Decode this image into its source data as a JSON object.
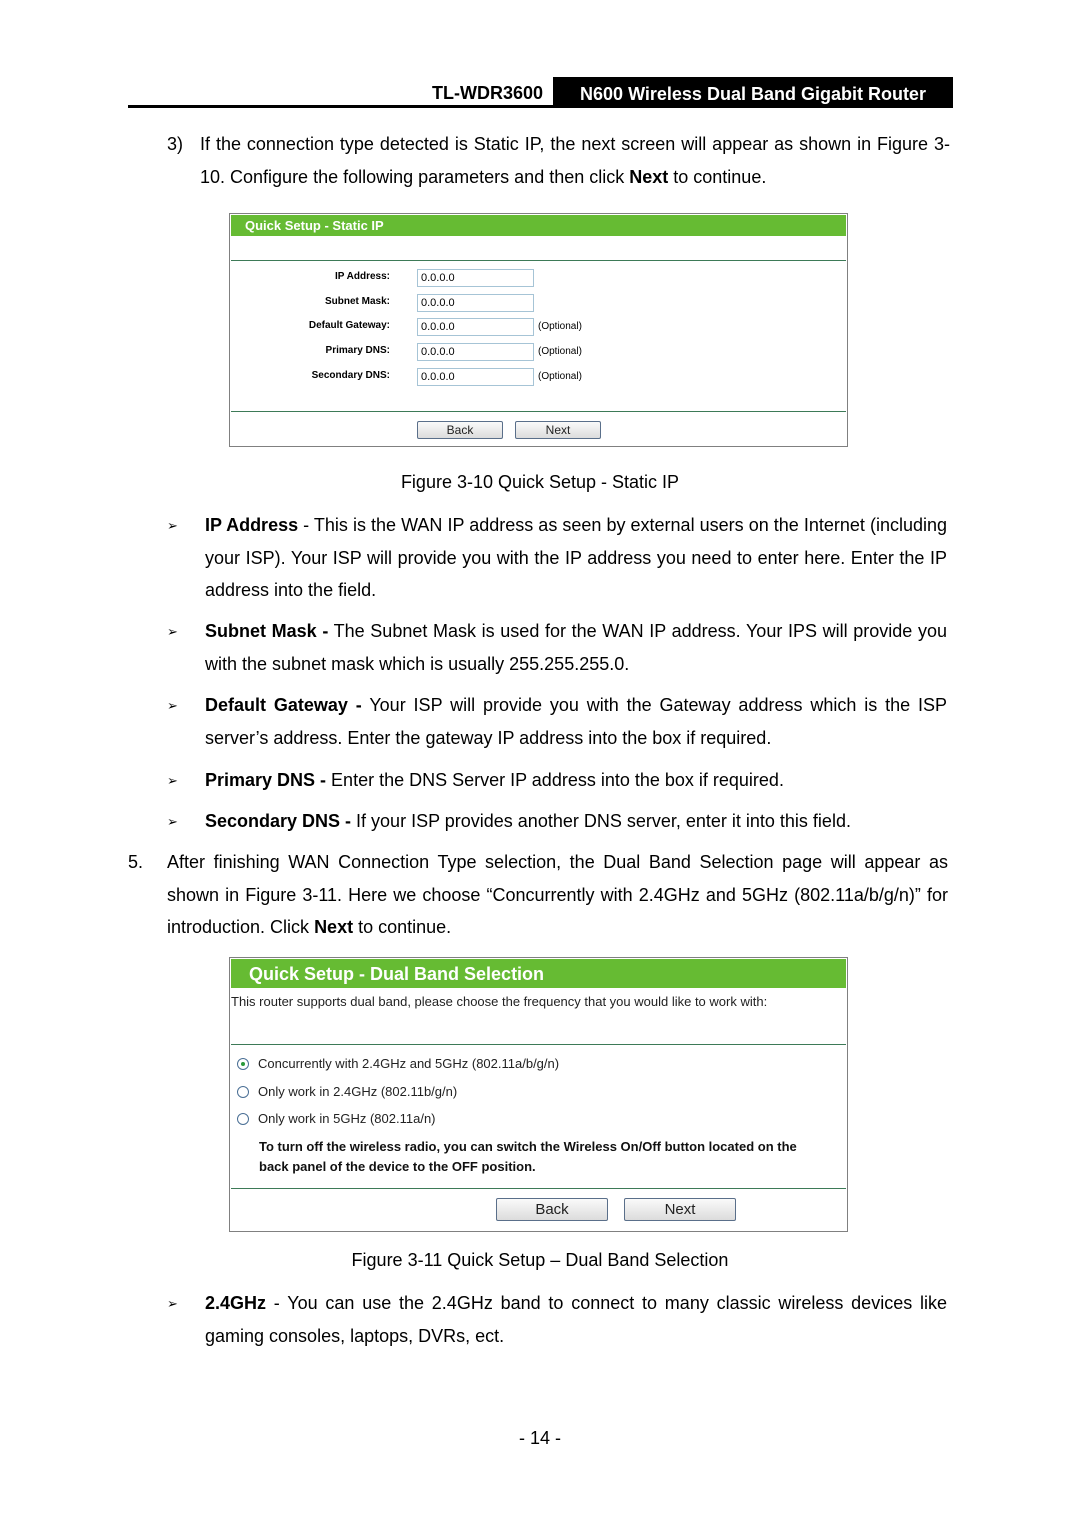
{
  "header": {
    "model": "TL-WDR3600",
    "product": "N600 Wireless Dual Band Gigabit Router"
  },
  "step3": {
    "num": "3)",
    "text_a": "If the connection type detected is Static IP, the next screen will appear as shown in Figure 3-10. Configure the following parameters and then click ",
    "bold": "Next",
    "text_b": " to continue."
  },
  "fig1": {
    "title": "Quick Setup - Static IP",
    "fields": [
      {
        "label": "IP Address:",
        "value": "0.0.0.0",
        "note": ""
      },
      {
        "label": "Subnet Mask:",
        "value": "0.0.0.0",
        "note": ""
      },
      {
        "label": "Default Gateway:",
        "value": "0.0.0.0",
        "note": "(Optional)"
      },
      {
        "label": "Primary DNS:",
        "value": "0.0.0.0",
        "note": "(Optional)"
      },
      {
        "label": "Secondary DNS:",
        "value": "0.0.0.0",
        "note": "(Optional)"
      }
    ],
    "back": "Back",
    "next": "Next",
    "caption": "Figure 3-10 Quick Setup - Static IP"
  },
  "bullets1": [
    {
      "bold": "IP Address",
      "text": " - This is the WAN IP address as seen by external users on the Internet (including your ISP). Your ISP will provide you with the IP address you need to enter here. Enter the IP address into the field."
    },
    {
      "bold": "Subnet Mask -",
      "text": " The Subnet Mask is used for the WAN IP address. Your IPS will provide you with the subnet mask which is usually 255.255.255.0."
    },
    {
      "bold": "Default Gateway -",
      "text": " Your ISP will provide you with the Gateway address which is the ISP server’s address. Enter the gateway IP address into the box if required."
    },
    {
      "bold": "Primary DNS -",
      "text": " Enter the DNS Server IP address into the box if required."
    },
    {
      "bold": "Secondary DNS -",
      "text": " If your ISP provides another DNS server, enter it into this field."
    }
  ],
  "step5": {
    "num": "5.",
    "text_a": "After finishing WAN Connection Type selection, the Dual Band Selection page will appear as shown in Figure 3-11. Here we choose “Concurrently with 2.4GHz and 5GHz (802.11a/b/g/n)” for introduction. Click ",
    "bold": "Next",
    "text_b": " to continue."
  },
  "fig2": {
    "title": "Quick Setup - Dual Band Selection",
    "intro": "This router supports dual band, please choose the frequency that you would like to work with:",
    "options": [
      {
        "label": "Concurrently with 2.4GHz and 5GHz (802.11a/b/g/n)",
        "selected": true
      },
      {
        "label": "Only work in 2.4GHz (802.11b/g/n)",
        "selected": false
      },
      {
        "label": "Only work in 5GHz (802.11a/n)",
        "selected": false
      }
    ],
    "note": "To turn off the wireless radio, you can switch the Wireless On/Off button located on the back panel of the device to the OFF position.",
    "back": "Back",
    "next": "Next",
    "caption": "Figure 3-11 Quick Setup – Dual Band Selection"
  },
  "bullets2": [
    {
      "bold": "2.4GHz",
      "text": " - You can use the 2.4GHz band to connect to many classic wireless devices like gaming consoles, laptops, DVRs, ect."
    }
  ],
  "page_number": "- 14 -"
}
